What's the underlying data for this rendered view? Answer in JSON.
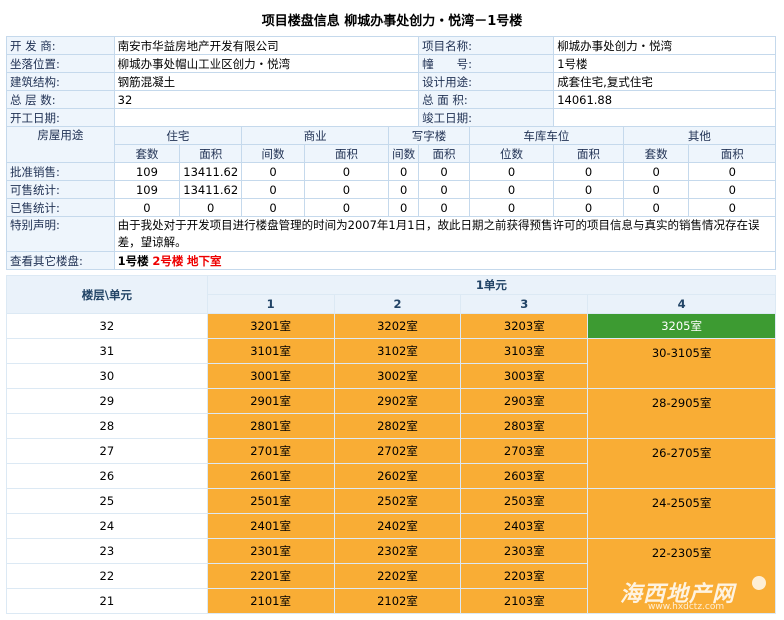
{
  "title": "项目楼盘信息  柳城办事处创力・悦湾－1号楼",
  "info": {
    "developer_label": "开 发 商:",
    "developer": "南安市华益房地产开发有限公司",
    "project_label": "项目名称:",
    "project": "柳城办事处创力・悦湾",
    "location_label": "坐落位置:",
    "location": "柳城办事处帽山工业区创力・悦湾",
    "building_label": "幢　　号:",
    "building": "1号楼",
    "structure_label": "建筑结构:",
    "structure": "钢筋混凝土",
    "usage_label": "设计用途:",
    "usage": "成套住宅,复式住宅",
    "floors_label": "总 层 数:",
    "floors": "32",
    "area_label": "总 面 积:",
    "area": "14061.88",
    "start_label": "开工日期:",
    "start": "",
    "finish_label": "竣工日期:",
    "finish": ""
  },
  "sales": {
    "use_label": "房屋用途",
    "categories": [
      "住宅",
      "商业",
      "写字楼",
      "车库车位",
      "其他"
    ],
    "sub": [
      "套数",
      "面积",
      "间数",
      "面积",
      "间数",
      "面积",
      "位数",
      "面积",
      "套数",
      "面积"
    ],
    "rows": [
      {
        "label": "批准销售:",
        "vals": [
          "109",
          "13411.62",
          "0",
          "0",
          "0",
          "0",
          "0",
          "0",
          "0",
          "0"
        ]
      },
      {
        "label": "可售统计:",
        "vals": [
          "109",
          "13411.62",
          "0",
          "0",
          "0",
          "0",
          "0",
          "0",
          "0",
          "0"
        ]
      },
      {
        "label": "已售统计:",
        "vals": [
          "0",
          "0",
          "0",
          "0",
          "0",
          "0",
          "0",
          "0",
          "0",
          "0"
        ]
      }
    ],
    "notice_label": "特别声明:",
    "notice": "由于我处对于开发项目进行楼盘管理的时间为2007年1月1日，故此日期之前获得预售许可的项目信息与真实的销售情况存在误差，望谅解。",
    "other_label": "查看其它楼盘:",
    "links": [
      "1号楼",
      "2号楼",
      "地下室"
    ]
  },
  "grid": {
    "corner": "楼层\\单元",
    "unit": "1单元",
    "cols": [
      "1",
      "2",
      "3",
      "4"
    ],
    "rows": [
      {
        "floor": "32",
        "r": [
          "3201室",
          "3202室",
          "3203室"
        ],
        "c4": "3205室"
      },
      {
        "floor": "31",
        "r": [
          "3101室",
          "3102室",
          "3103室"
        ],
        "c4": "30-3105室"
      },
      {
        "floor": "30",
        "r": [
          "3001室",
          "3002室",
          "3003室"
        ]
      },
      {
        "floor": "29",
        "r": [
          "2901室",
          "2902室",
          "2903室"
        ],
        "c4": "28-2905室"
      },
      {
        "floor": "28",
        "r": [
          "2801室",
          "2802室",
          "2803室"
        ]
      },
      {
        "floor": "27",
        "r": [
          "2701室",
          "2702室",
          "2703室"
        ],
        "c4": "26-2705室"
      },
      {
        "floor": "26",
        "r": [
          "2601室",
          "2602室",
          "2603室"
        ]
      },
      {
        "floor": "25",
        "r": [
          "2501室",
          "2502室",
          "2503室"
        ],
        "c4": "24-2505室"
      },
      {
        "floor": "24",
        "r": [
          "2401室",
          "2402室",
          "2403室"
        ]
      },
      {
        "floor": "23",
        "r": [
          "2301室",
          "2302室",
          "2303室"
        ],
        "c4": "22-2305室"
      },
      {
        "floor": "22",
        "r": [
          "2201室",
          "2202室",
          "2203室"
        ]
      },
      {
        "floor": "21",
        "r": [
          "2101室",
          "2102室",
          "2103室"
        ]
      }
    ]
  },
  "watermark": {
    "main": "海西地产网",
    "url": "www.hxdctz.com"
  },
  "colors": {
    "available": "#f9ad35",
    "highlight": "#3d9b32",
    "header_bg": "#eaf2fa",
    "border": "#c5d9ec"
  }
}
